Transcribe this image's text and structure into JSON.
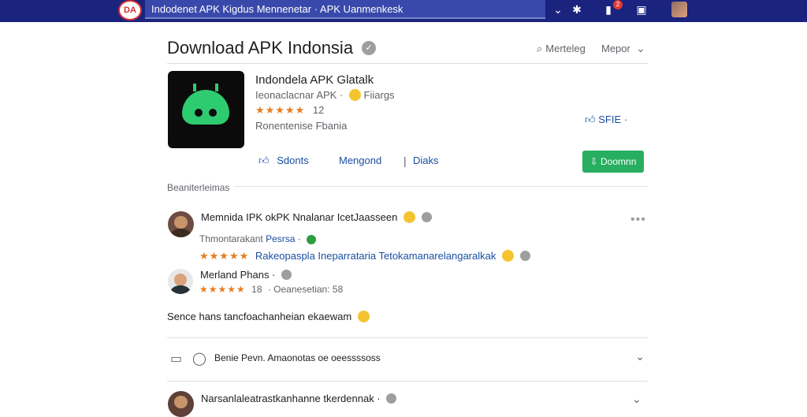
{
  "topbar": {
    "logo_text": "DA",
    "search_text": "Indodenet APK  Kigdus  Mennenetar · APK Uanmenkesk",
    "icons": [
      "chevron-down-icon",
      "puzzle-icon",
      "notification-icon",
      "chat-icon",
      "profile-avatar"
    ],
    "badge_count": "2"
  },
  "header": {
    "title": "Download APK Indonsia",
    "link_search": "Merteleg",
    "link_menu": "Mepor"
  },
  "app": {
    "name": "Indondela APK Glatalk",
    "subtitle": "Ieonaclacnar APK ·",
    "subtitle_tag": "Fiiargs",
    "rating_value": "12",
    "developer": "Ronentenise Fbania",
    "like_label": "SFIE",
    "accent_color": "#27ae60"
  },
  "actions": {
    "tab1": "Sdonts",
    "tab2": "Mengond",
    "tab3": "Diaks",
    "download_label": "Doomnn"
  },
  "comments": {
    "section_label": "Beaniterleimas",
    "c1_title": "Memnida IPK okPK Nnalanar IcetJaasseen",
    "c1_meta_name": "Thmontarakant",
    "c1_meta_link": "Pesrsa ·",
    "c1_body": "Rakeopaspla Ineparrataria Tetokamanarelangaralkak",
    "c2_name": "Merland Phans ·",
    "c2_rating": "18",
    "c2_meta": "· Oeanesetian: 58",
    "c3_body": "Sence hans tancfoachanheian ekaewam",
    "reply_text": "Benie  Pevn. Amaonotas oe oeessssoss",
    "c4_title": "Narsanlaleatrastkanhanne tkerdennak ·"
  }
}
